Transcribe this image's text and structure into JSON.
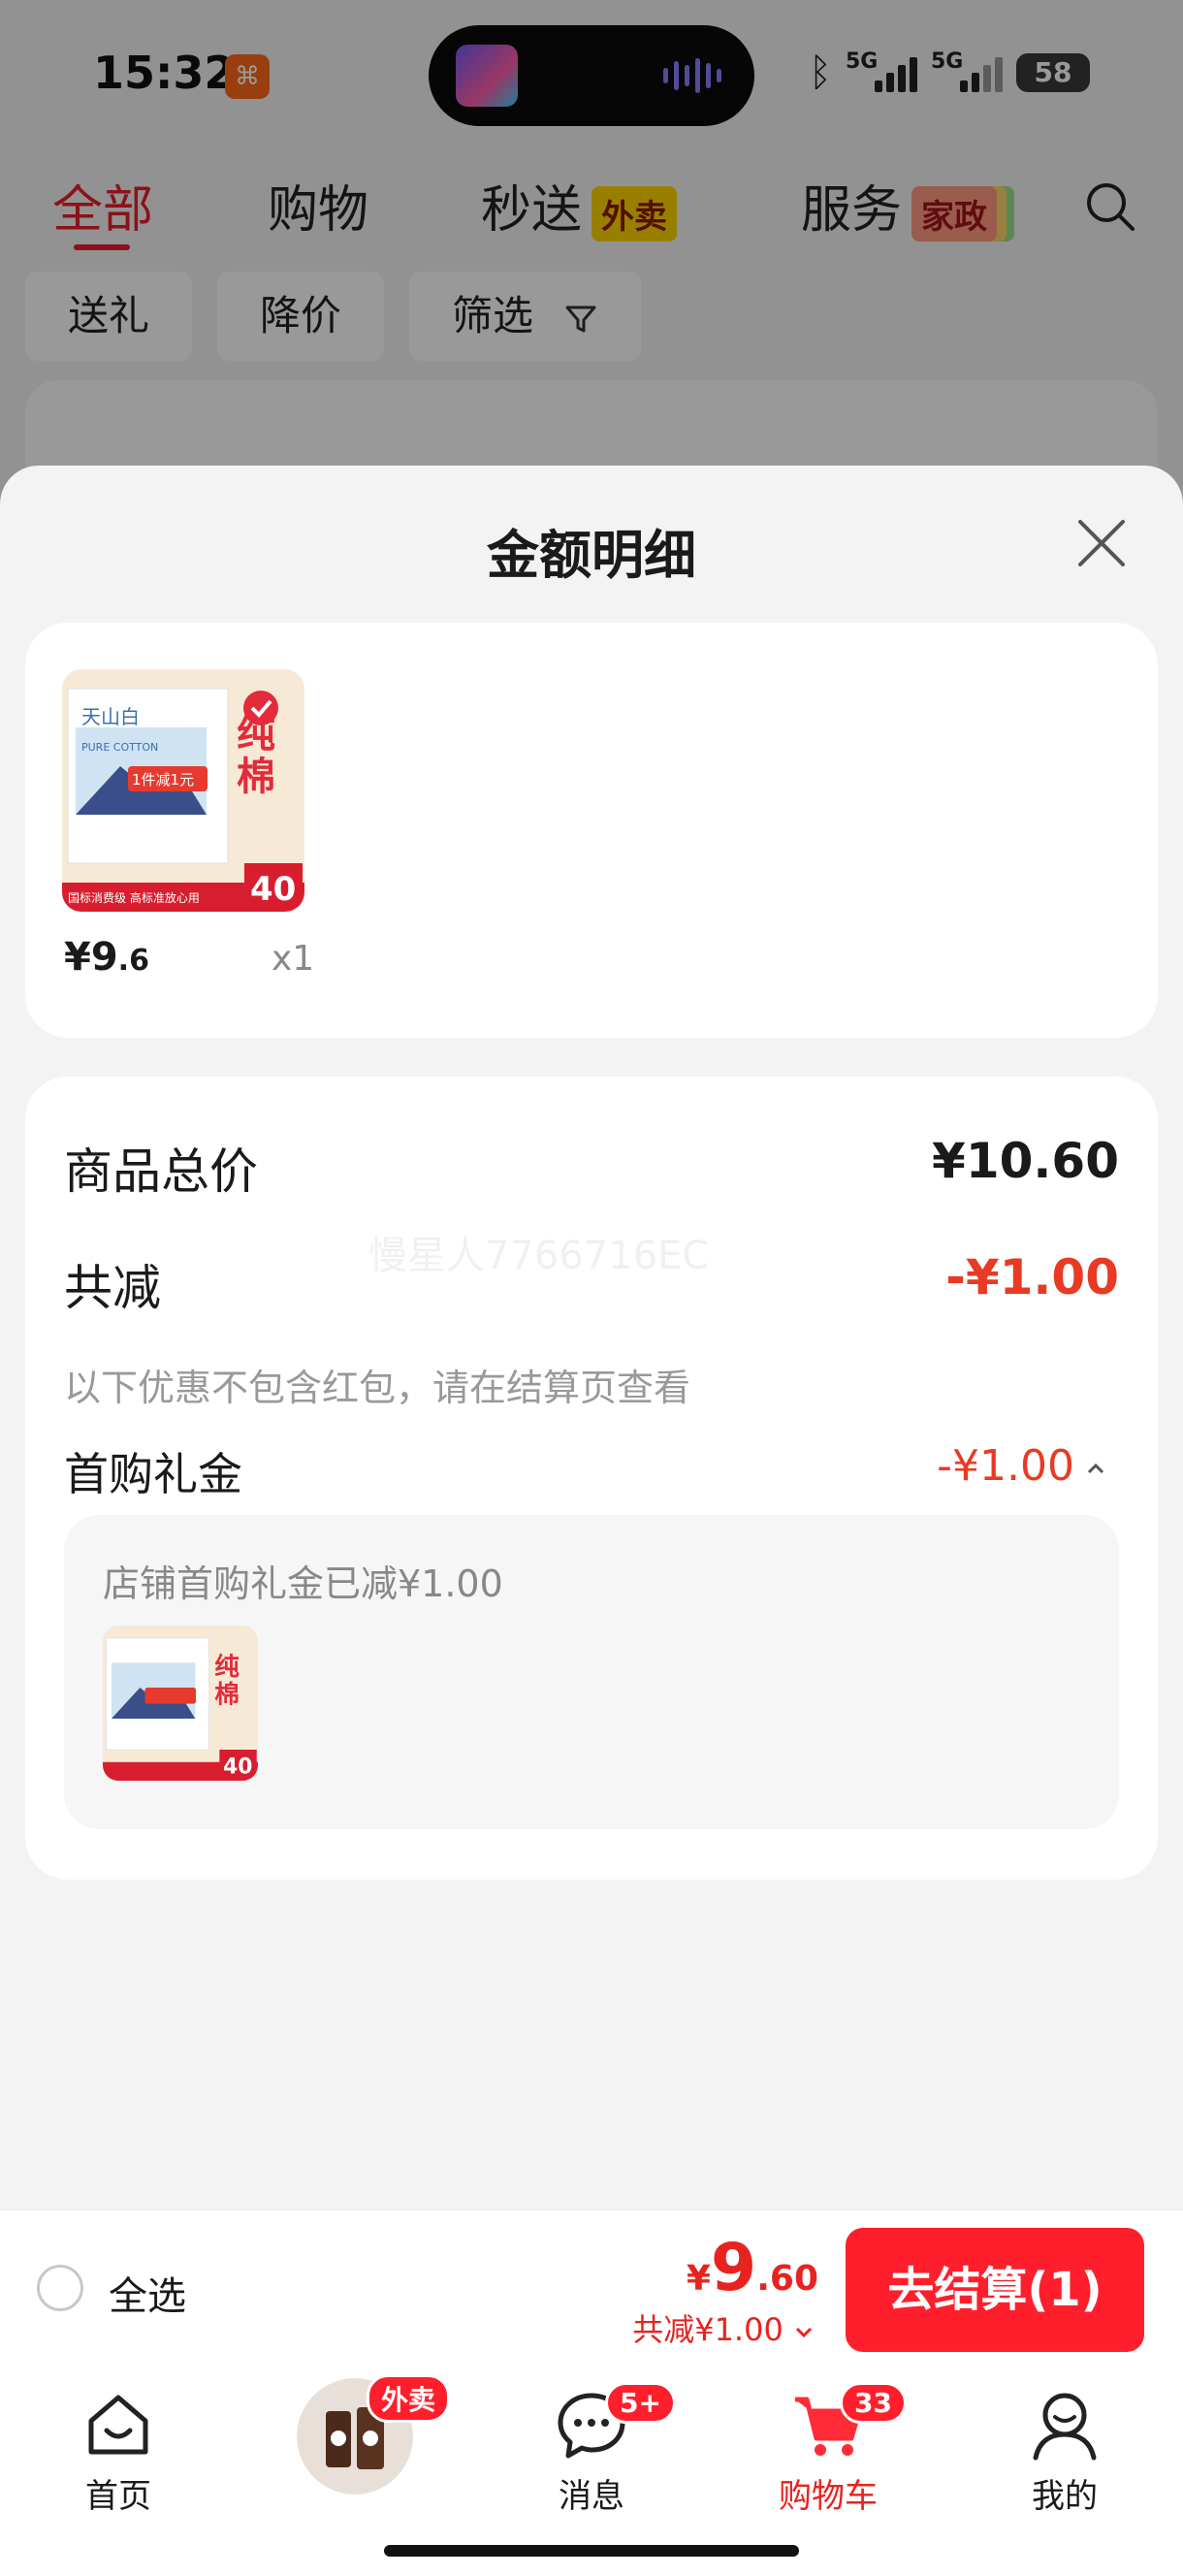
{
  "status_bar": {
    "time": "15:32",
    "battery": "58",
    "signal1": "5G",
    "signal2": "5G"
  },
  "top_tabs": [
    {
      "label": "全部"
    },
    {
      "label": "购物"
    },
    {
      "label": "秒送",
      "badge": "外卖"
    },
    {
      "label": "服务",
      "badge": "家政"
    }
  ],
  "filter_chips": [
    "送礼",
    "降价",
    "筛选"
  ],
  "sheet": {
    "title": "金额明细",
    "product": {
      "price_int": "¥9",
      "price_dec": ".6",
      "quantity": "x1"
    },
    "summary": {
      "total_label": "商品总价",
      "total_value": "¥10.60",
      "discount_label": "共减",
      "discount_value": "-¥1.00",
      "note": "以下优惠不包含红包，请在结算页查看",
      "gift_label": "首购礼金",
      "gift_value": "-¥1.00",
      "detail_text": "店铺首购礼金已减¥1.00",
      "watermark": "慢星人7766716EC"
    }
  },
  "checkout": {
    "select_all": "全选",
    "price_currency": "¥",
    "price_int": "9",
    "price_dec": ".60",
    "discount": "共减¥1.00",
    "button": "去结算(1)"
  },
  "bottom_nav": [
    {
      "label": "首页"
    },
    {
      "label": "",
      "badge": "外卖"
    },
    {
      "label": "消息",
      "badge": "5+"
    },
    {
      "label": "购物车",
      "badge": "33"
    },
    {
      "label": "我的"
    }
  ],
  "product_image_text": {
    "brand": "天山白",
    "series": "PURE COTTON",
    "promo": "1件减1元",
    "side": "纯棉",
    "count": "40",
    "note": "国标消费级 高标准放心用"
  },
  "colors": {
    "accent_red": "#e8231f",
    "discount_orange": "#e83a25",
    "active_tab": "#e81e2a"
  }
}
